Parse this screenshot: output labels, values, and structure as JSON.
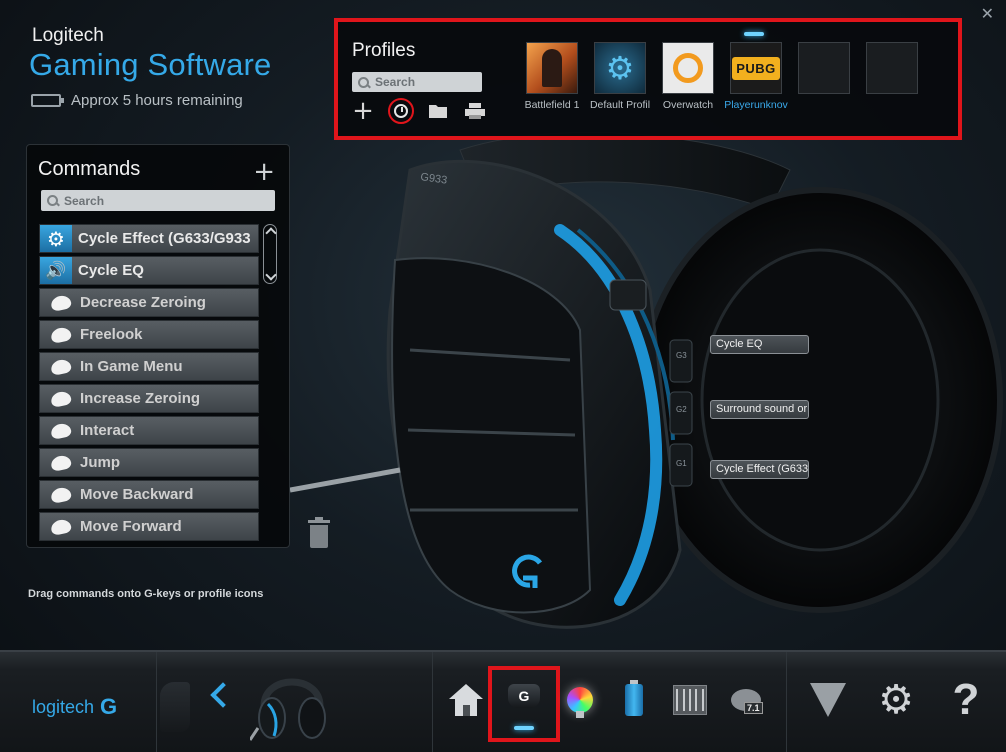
{
  "window": {
    "close_label": "✕"
  },
  "brand": {
    "top": "Logitech",
    "main": "Gaming Software",
    "battery_text": "Approx 5 hours remaining",
    "battery_level": 0.0
  },
  "profiles": {
    "title": "Profiles",
    "search_placeholder": "Search",
    "tools": [
      "add-profile",
      "history",
      "open-folder",
      "print"
    ],
    "items": [
      {
        "label": "Battlefield 1",
        "icon": "battlefield-1-art",
        "active": false
      },
      {
        "label": "Default Profil",
        "icon": "gear-icon",
        "active": false
      },
      {
        "label": "Overwatch",
        "icon": "overwatch-logo",
        "active": false
      },
      {
        "label": "Playerunknov",
        "icon": "pubg-logo",
        "badge": "PUBG",
        "active": true
      },
      {
        "label": "",
        "icon": "empty-slot",
        "active": false
      },
      {
        "label": "",
        "icon": "empty-slot",
        "active": false
      }
    ]
  },
  "commands": {
    "title": "Commands",
    "add_label": "+",
    "search_placeholder": "Search",
    "items": [
      {
        "label": "Cycle Effect (G633/G933",
        "icon": "function-gear-icon",
        "type": "function"
      },
      {
        "label": "Cycle EQ",
        "icon": "speaker-icon",
        "type": "function"
      },
      {
        "label": "Decrease Zeroing",
        "icon": "key-icon",
        "type": "key"
      },
      {
        "label": "Freelook",
        "icon": "key-icon",
        "type": "key"
      },
      {
        "label": "In Game Menu",
        "icon": "key-icon",
        "type": "key"
      },
      {
        "label": "Increase Zeroing",
        "icon": "key-icon",
        "type": "key"
      },
      {
        "label": "Interact",
        "icon": "key-icon",
        "type": "key"
      },
      {
        "label": "Jump",
        "icon": "key-icon",
        "type": "key"
      },
      {
        "label": "Move Backward",
        "icon": "key-icon",
        "type": "key"
      },
      {
        "label": "Move Forward",
        "icon": "key-icon",
        "type": "key"
      }
    ]
  },
  "hint": "Drag commands onto G-keys or profile icons",
  "headset": {
    "model_text": "G933",
    "callouts": [
      "Cycle EQ",
      "Surround sound or",
      "Cycle Effect (G633"
    ],
    "key_labels": [
      "G3",
      "G2",
      "G1"
    ]
  },
  "bottombar": {
    "logo_text": "logitech",
    "logo_mark": "G",
    "gkey_label": "G",
    "surround_badge": "7.1",
    "help_label": "?",
    "gear_label": "⚙"
  },
  "colors": {
    "accent": "#35a9e8",
    "highlight_red": "#e0151b",
    "glow": "#6fd4ff"
  }
}
